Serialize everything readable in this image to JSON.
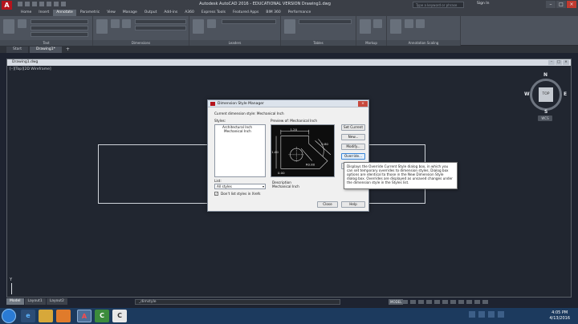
{
  "window": {
    "app_logo": "A",
    "title": "Autodesk AutoCAD 2016 - EDUCATIONAL VERSION    Drawing1.dwg",
    "search_placeholder": "Type a keyword or phrase",
    "signin": "Sign In",
    "min": "–",
    "max": "□",
    "close": "×"
  },
  "ribbon": {
    "tabs": [
      "Home",
      "Insert",
      "Annotate",
      "Parametric",
      "View",
      "Manage",
      "Output",
      "Add-ins",
      "A360",
      "Express Tools",
      "Featured Apps",
      "BIM 360",
      "Performance"
    ],
    "active_tab": "Annotate",
    "panels": [
      "Text",
      "Dimensions",
      "Leaders",
      "Tables",
      "Markup",
      "Annotation Scaling"
    ]
  },
  "file_tabs": {
    "start": "Start",
    "drawing": "Drawing1*",
    "add": "+"
  },
  "drawing_window": {
    "title": "Drawing1.dwg",
    "viewport_label": "[–][Top][2D Wireframe]",
    "min": "–",
    "max": "□",
    "close": "×"
  },
  "viewcube": {
    "top": "TOP",
    "n": "N",
    "s": "S",
    "e": "E",
    "w": "W",
    "wcs": "WCS"
  },
  "ucs": {
    "y_label": "Y"
  },
  "layout_tabs": [
    "Model",
    "Layout1",
    "Layout2"
  ],
  "command_line": "_dimstyle",
  "status": {
    "model": "MODEL"
  },
  "dialog": {
    "title": "Dimension Style Manager",
    "close": "×",
    "current_style": "Current dimension style: Mechanical Inch",
    "styles_label": "Styles:",
    "styles": [
      "Architectural Inch",
      "Mechanical Inch"
    ],
    "preview_label": "Preview of: Mechanical Inch",
    "list_label": "List:",
    "list_value": "All styles",
    "checkbox_label": "Don't list styles in Xrefs",
    "description_label": "Description",
    "description_value": "Mechanical Inch",
    "buttons": {
      "set_current": "Set Current",
      "new": "New...",
      "modify": "Modify...",
      "override": "Override...",
      "compare": "Compare...",
      "close": "Close",
      "help": "Help"
    },
    "preview_dims": {
      "d1": "1.20",
      "d2": "1.00",
      "d3": "0.80",
      "d4": "R0.80",
      "d5": "0.00"
    }
  },
  "tooltip": "Displays the Override Current Style dialog box, in which you can set temporary overrides to dimension styles. Dialog box options are identical to those in the New Dimension Style dialog box. Overrides are displayed as unsaved changes under the dimension style in the Styles list.",
  "taskbar": {
    "apps": [
      "e",
      "",
      "",
      "",
      "A",
      "C",
      "",
      "C"
    ],
    "time": "4:05 PM",
    "date": "4/13/2016"
  }
}
